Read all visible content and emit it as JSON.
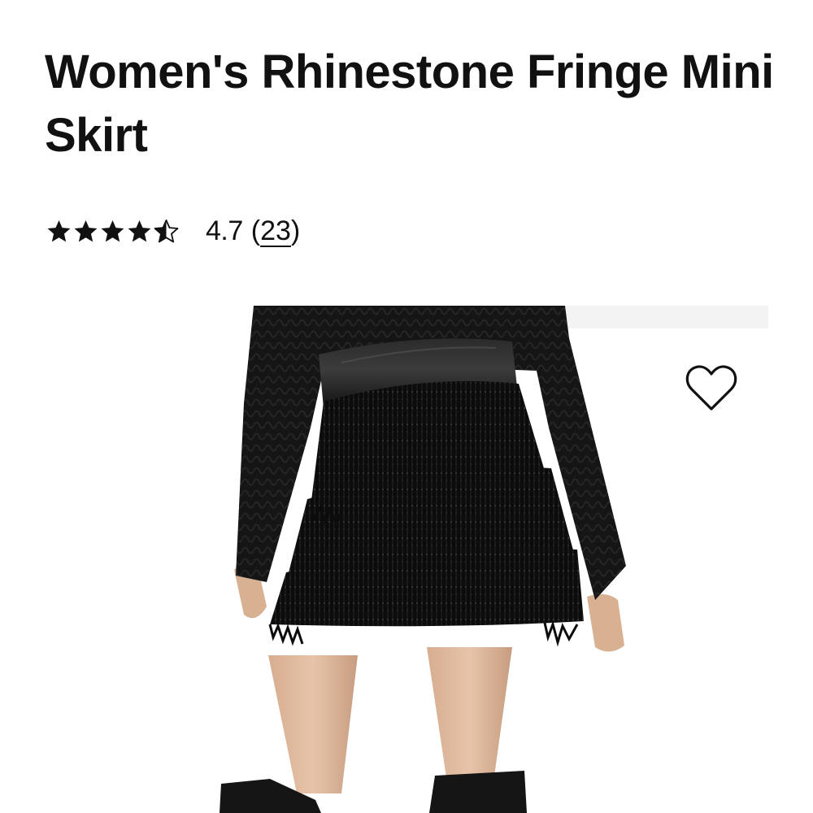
{
  "product": {
    "title": "Women's Rhinestone Fringe Mini Skirt",
    "rating": {
      "value": "4.7",
      "stars": 4.7,
      "review_count": "23",
      "open_paren": "(",
      "close_paren": ")"
    },
    "image": {
      "alt": "Model wearing black rhinestone fringe mini skirt with black leather waistband, black knit sweater and black boots"
    },
    "wishlist": {
      "icon": "heart-outline-icon",
      "aria_label": "Add to wishlist"
    }
  },
  "colors": {
    "text": "#111111",
    "background": "#ffffff"
  }
}
